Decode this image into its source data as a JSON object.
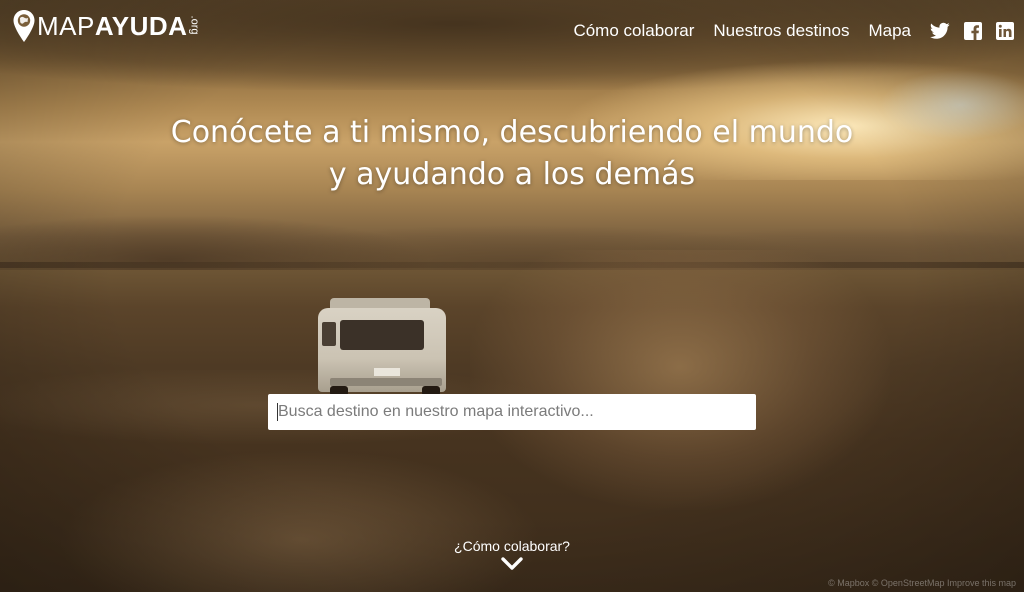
{
  "brand": {
    "map": "MAP",
    "ayuda": "AYUDA",
    "org": ".org"
  },
  "nav": {
    "links": [
      {
        "label": "Cómo colaborar"
      },
      {
        "label": "Nuestros destinos"
      },
      {
        "label": "Mapa"
      }
    ],
    "social": [
      "twitter-icon",
      "facebook-icon",
      "linkedin-icon"
    ]
  },
  "hero": {
    "headline_line1": "Conócete a ti mismo, descubriendo el mundo",
    "headline_line2": "y ayudando a los demás"
  },
  "search": {
    "placeholder": "Busca destino en nuestro mapa interactivo...",
    "value": ""
  },
  "footer": {
    "cta": "¿Cómo colaborar?",
    "attribution": "© Mapbox © OpenStreetMap Improve this map"
  },
  "colors": {
    "text": "#ffffff",
    "search_bg": "#ffffff"
  }
}
